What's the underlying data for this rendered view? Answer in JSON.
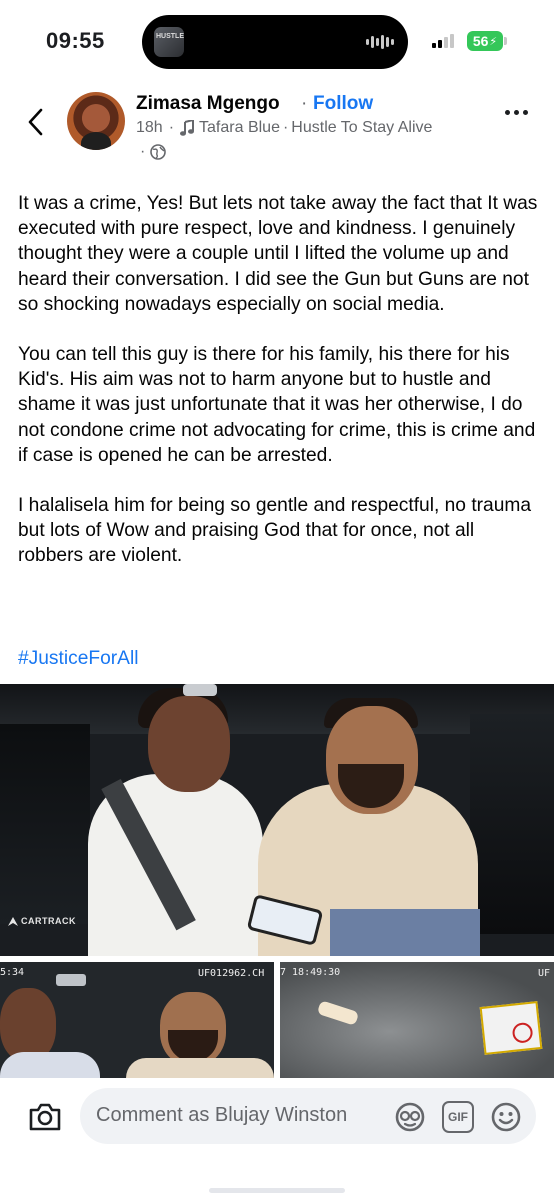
{
  "status_bar": {
    "time": "09:55",
    "battery": "56",
    "now_playing_label": "HUSTLE"
  },
  "post": {
    "author": "Zimasa Mgengo",
    "separator": "·",
    "follow_label": "Follow",
    "time_ago": "18h",
    "music_artist": "Tafara Blue",
    "music_title": "Hustle To Stay Alive",
    "audience_icon": "globe-icon",
    "paragraphs": [
      "It was a crime, Yes! But lets not take away the fact that It was executed with pure respect, love and kindness. I genuinely thought they were a couple until I lifted the volume up and heard their conversation. I did see the Gun but Guns are not so shocking nowadays especially on social media.",
      "You can tell this guy is there for his family, his there for his Kid's. His aim was not to harm anyone but to hustle and shame it was just unfortunate that it was her otherwise, I do not condone crime not advocating for crime, this is crime and if case is opened he can be arrested.",
      "I halalisela him for being so gentle and respectful,  no trauma but lots of Wow and praising God that for once, not all robbers are violent."
    ],
    "hashtag": "#JusticeForAll"
  },
  "photos": {
    "main_logo": "CARTRACK",
    "left_timestamp": "5:34",
    "left_overlay_id": "UF012962.CH",
    "right_timestamp": "7 18:49:30",
    "right_overlay_id": "UF"
  },
  "comment_bar": {
    "placeholder": "Comment as Blujay Winston",
    "gif_label": "GIF",
    "icons": [
      "camera-icon",
      "avatar-sticker-icon",
      "gif-icon",
      "emoji-icon"
    ]
  }
}
